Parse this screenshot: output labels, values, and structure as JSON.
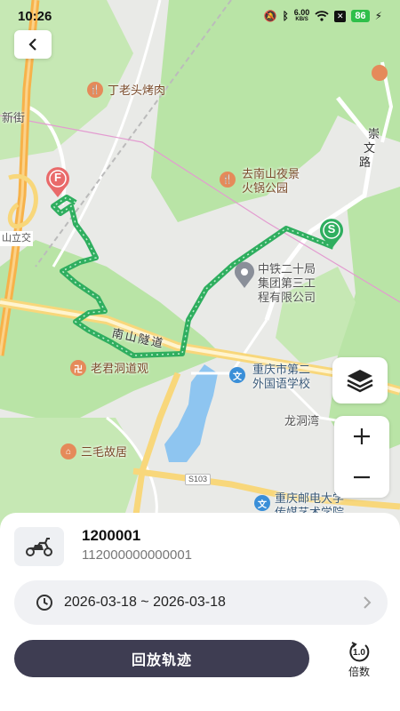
{
  "status_bar": {
    "time": "10:26",
    "net_speed_value": "6.00",
    "net_speed_unit": "KB/S",
    "battery": "86"
  },
  "map": {
    "labels": {
      "dinglaotou": "丁老头烤肉",
      "xinjie": "新街",
      "qunanshan_1": "去南山夜景",
      "qunanshan_2": "火锅公园",
      "chongwen_1": "崇",
      "chongwen_2": "文",
      "chongwen_3": "路",
      "shanlijiao": "山立交",
      "zhongtie_1": "中铁二十局",
      "zhongtie_2": "集团第三工",
      "zhongtie_3": "程有限公司",
      "nanshan_tunnel": "南山隧道",
      "laojundong": "老君洞道观",
      "chongqing_school_1": "重庆市第二",
      "chongqing_school_2": "外国语学校",
      "longdongwan": "龙洞湾",
      "sanmao": "三毛故居",
      "s103": "S103",
      "youdian_1": "重庆邮电大学",
      "youdian_2": "传媒艺术学院"
    },
    "markers": {
      "start": "S",
      "finish": "F"
    }
  },
  "sheet": {
    "vehicle_name": "1200001",
    "vehicle_id": "112000000000001",
    "date_range": "2026-03-18 ~ 2026-03-18",
    "replay_label": "回放轨迹",
    "speed_value": "1.0",
    "speed_label": "倍数"
  },
  "colors": {
    "track": "#2fae5f",
    "replay_button": "#3e3d52",
    "park_green": "#b9e4a6",
    "highway": "#f7b24a"
  },
  "icons": {
    "back": "chevron-left-icon",
    "layers": "layers-icon",
    "zoom_in": "plus-icon",
    "zoom_out": "minus-icon",
    "clock": "clock-icon",
    "chevron_right": "chevron-right-icon",
    "scooter": "scooter-icon",
    "speed": "speed-icon"
  }
}
